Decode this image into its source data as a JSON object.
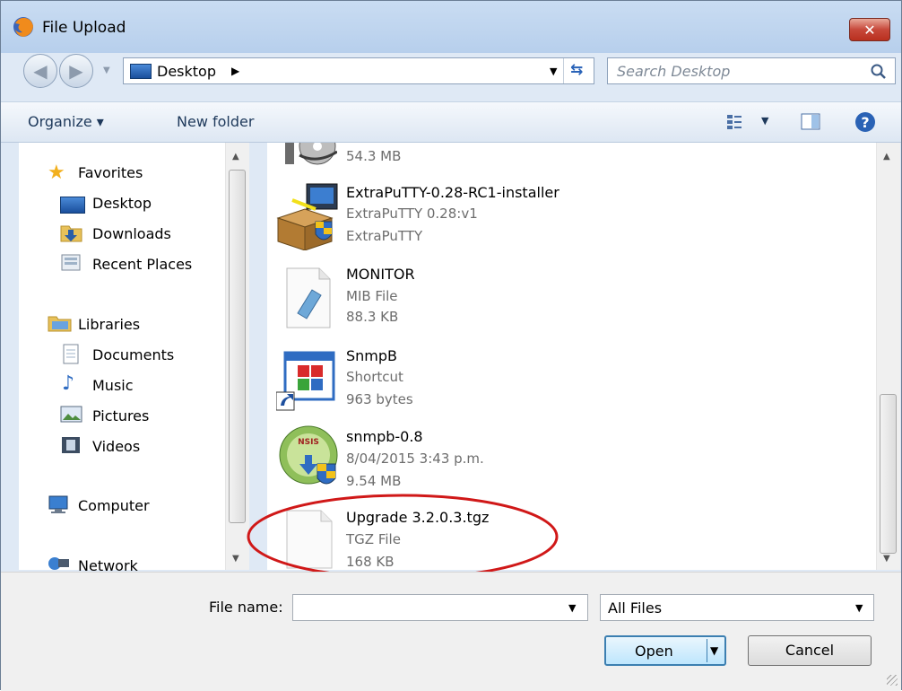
{
  "window": {
    "title": "File Upload",
    "close_label": "✕"
  },
  "address": {
    "location": "Desktop",
    "search_placeholder": "Search Desktop"
  },
  "toolbar": {
    "organize_label": "Organize ▾",
    "new_folder_label": "New folder"
  },
  "sidebar": {
    "favorites_label": "Favorites",
    "favorites": [
      "Desktop",
      "Downloads",
      "Recent Places"
    ],
    "libraries_label": "Libraries",
    "libraries": [
      "Documents",
      "Music",
      "Pictures",
      "Videos"
    ],
    "computer_label": "Computer",
    "network_label": "Network"
  },
  "files": [
    {
      "name": "",
      "line1": "54.3 MB",
      "line2": ""
    },
    {
      "name": "ExtraPuTTY-0.28-RC1-installer",
      "line1": "ExtraPuTTY 0.28:v1",
      "line2": "ExtraPuTTY"
    },
    {
      "name": "MONITOR",
      "line1": "MIB File",
      "line2": "88.3 KB"
    },
    {
      "name": "SnmpB",
      "line1": "Shortcut",
      "line2": "963 bytes"
    },
    {
      "name": "snmpb-0.8",
      "line1": "8/04/2015 3:43 p.m.",
      "line2": "9.54 MB"
    },
    {
      "name": "Upgrade 3.2.0.3.tgz",
      "line1": "TGZ File",
      "line2": "168 KB"
    }
  ],
  "footer": {
    "file_name_label": "File name:",
    "file_name_value": "",
    "filter_value": "All Files",
    "open_label": "Open",
    "cancel_label": "Cancel"
  },
  "colors": {
    "highlight_circle": "#d01818",
    "accent": "#1e395b"
  }
}
